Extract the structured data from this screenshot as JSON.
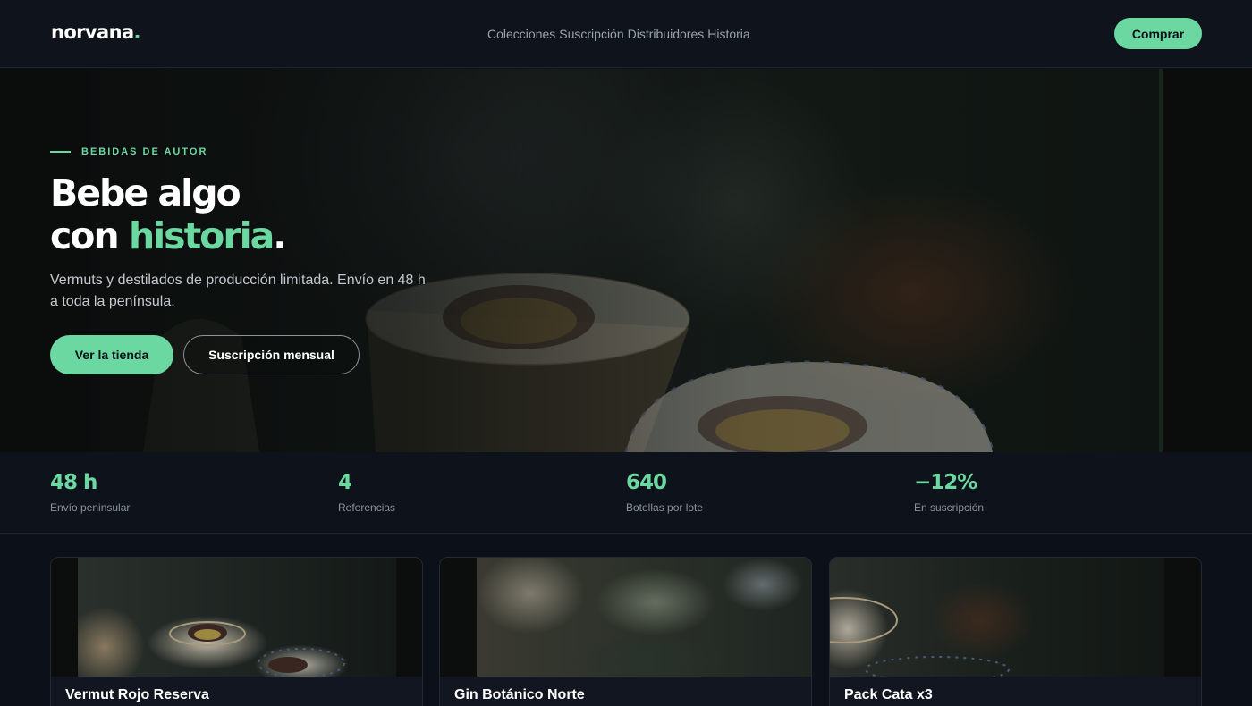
{
  "brand": {
    "name": "norvana",
    "dot": "."
  },
  "nav": {
    "items": [
      "Colecciones",
      "Suscripción",
      "Distribuidores",
      "Historia"
    ],
    "cta": "Comprar"
  },
  "hero": {
    "eyebrow": "BEBIDAS DE AUTOR",
    "title_line1": "Bebe algo",
    "title_line2_prefix": "con ",
    "title_line2_accent": "historia",
    "title_line2_suffix": ".",
    "subtitle": "Vermuts y destilados de producción limitada. Envío en 48 h a toda la península.",
    "primary_button": "Ver la tienda",
    "secondary_button": "Suscripción mensual"
  },
  "stats": [
    {
      "value": "48 h",
      "label": "Envío peninsular"
    },
    {
      "value": "4",
      "label": "Referencias"
    },
    {
      "value": "640",
      "label": "Botellas por lote"
    },
    {
      "value": "−12%",
      "label": "En suscripción"
    }
  ],
  "products": [
    {
      "name": "Vermut Rojo Reserva"
    },
    {
      "name": "Gin Botánico Norte"
    },
    {
      "name": "Pack Cata x3"
    }
  ],
  "colors": {
    "accent": "#6ad8a0",
    "background": "#0c1018",
    "header": "#0f131c"
  }
}
